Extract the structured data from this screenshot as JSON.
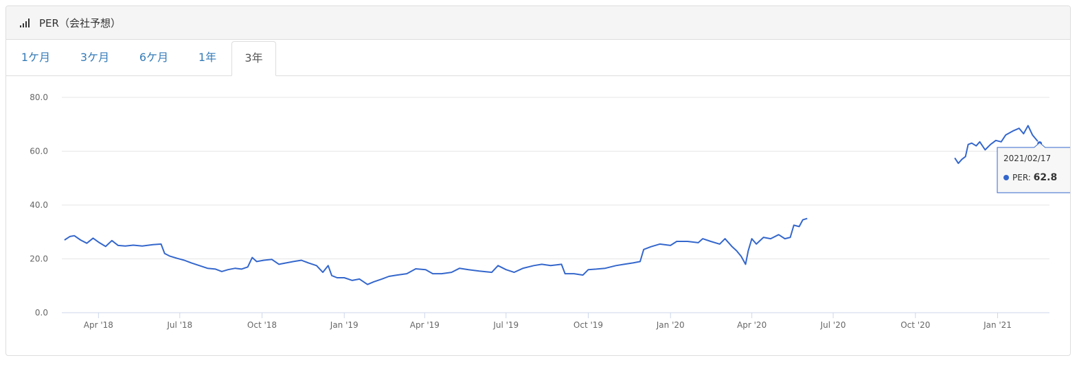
{
  "panel": {
    "title": "PER（会社予想）",
    "icon": "signal-bars-icon"
  },
  "tabs": [
    {
      "label": "1ケ月",
      "active": false
    },
    {
      "label": "3ケ月",
      "active": false
    },
    {
      "label": "6ケ月",
      "active": false
    },
    {
      "label": "1年",
      "active": false
    },
    {
      "label": "3年",
      "active": true
    }
  ],
  "colors": {
    "line": "#3366cc",
    "grid": "#e6e6e6",
    "tab_link": "#337ab7"
  },
  "chart_data": {
    "type": "line",
    "title": "",
    "xlabel": "",
    "ylabel": "",
    "ylim": [
      0,
      80
    ],
    "yticks": [
      "0.0",
      "20.0",
      "40.0",
      "60.0",
      "80.0"
    ],
    "xlim": [
      "2018-02-19",
      "2021-02-28"
    ],
    "xticks": [
      {
        "date": "2018-04-01",
        "label": "Apr '18"
      },
      {
        "date": "2018-07-01",
        "label": "Jul '18"
      },
      {
        "date": "2018-10-01",
        "label": "Oct '18"
      },
      {
        "date": "2019-01-01",
        "label": "Jan '19"
      },
      {
        "date": "2019-04-01",
        "label": "Apr '19"
      },
      {
        "date": "2019-07-01",
        "label": "Jul '19"
      },
      {
        "date": "2019-10-01",
        "label": "Oct '19"
      },
      {
        "date": "2020-01-01",
        "label": "Jan '20"
      },
      {
        "date": "2020-04-01",
        "label": "Apr '20"
      },
      {
        "date": "2020-07-01",
        "label": "Jul '20"
      },
      {
        "date": "2020-10-01",
        "label": "Oct '20"
      },
      {
        "date": "2021-01-01",
        "label": "Jan '21"
      }
    ],
    "grid": true,
    "legend": "none",
    "series": [
      {
        "name": "PER",
        "segments": [
          [
            [
              "2018-02-22",
              27.0
            ],
            [
              "2018-02-28",
              28.3
            ],
            [
              "2018-03-05",
              28.6
            ],
            [
              "2018-03-12",
              27.0
            ],
            [
              "2018-03-19",
              25.8
            ],
            [
              "2018-03-26",
              27.7
            ],
            [
              "2018-04-02",
              26.0
            ],
            [
              "2018-04-09",
              24.6
            ],
            [
              "2018-04-16",
              26.8
            ],
            [
              "2018-04-23",
              25.0
            ],
            [
              "2018-05-01",
              24.8
            ],
            [
              "2018-05-10",
              25.1
            ],
            [
              "2018-05-20",
              24.8
            ],
            [
              "2018-06-01",
              25.3
            ],
            [
              "2018-06-10",
              25.5
            ],
            [
              "2018-06-14",
              22.0
            ],
            [
              "2018-06-20",
              21.0
            ],
            [
              "2018-06-28",
              20.2
            ],
            [
              "2018-07-06",
              19.5
            ],
            [
              "2018-07-14",
              18.5
            ],
            [
              "2018-07-23",
              17.5
            ],
            [
              "2018-08-01",
              16.5
            ],
            [
              "2018-08-10",
              16.2
            ],
            [
              "2018-08-17",
              15.3
            ],
            [
              "2018-08-24",
              16.0
            ],
            [
              "2018-09-01",
              16.5
            ],
            [
              "2018-09-08",
              16.2
            ],
            [
              "2018-09-15",
              17.0
            ],
            [
              "2018-09-20",
              20.5
            ],
            [
              "2018-09-25",
              19.0
            ],
            [
              "2018-10-03",
              19.5
            ],
            [
              "2018-10-12",
              19.8
            ],
            [
              "2018-10-20",
              18.0
            ],
            [
              "2018-10-28",
              18.5
            ],
            [
              "2018-11-05",
              19.0
            ],
            [
              "2018-11-14",
              19.5
            ],
            [
              "2018-11-22",
              18.5
            ],
            [
              "2018-12-01",
              17.5
            ],
            [
              "2018-12-08",
              15.0
            ],
            [
              "2018-12-14",
              17.5
            ],
            [
              "2018-12-18",
              13.8
            ],
            [
              "2018-12-24",
              13.0
            ],
            [
              "2019-01-01",
              13.0
            ],
            [
              "2019-01-10",
              12.0
            ],
            [
              "2019-01-18",
              12.5
            ],
            [
              "2019-01-27",
              10.5
            ],
            [
              "2019-02-03",
              11.5
            ],
            [
              "2019-02-12",
              12.5
            ],
            [
              "2019-02-20",
              13.5
            ],
            [
              "2019-03-01",
              14.0
            ],
            [
              "2019-03-12",
              14.5
            ],
            [
              "2019-03-22",
              16.3
            ],
            [
              "2019-04-02",
              16.0
            ],
            [
              "2019-04-10",
              14.5
            ],
            [
              "2019-04-20",
              14.5
            ],
            [
              "2019-05-01",
              15.0
            ],
            [
              "2019-05-10",
              16.5
            ],
            [
              "2019-05-20",
              16.0
            ],
            [
              "2019-06-01",
              15.5
            ],
            [
              "2019-06-15",
              15.0
            ],
            [
              "2019-06-22",
              17.5
            ],
            [
              "2019-07-01",
              16.0
            ],
            [
              "2019-07-10",
              15.0
            ],
            [
              "2019-07-20",
              16.5
            ],
            [
              "2019-08-01",
              17.5
            ],
            [
              "2019-08-10",
              18.0
            ],
            [
              "2019-08-20",
              17.5
            ],
            [
              "2019-09-01",
              18.0
            ],
            [
              "2019-09-05",
              14.5
            ],
            [
              "2019-09-15",
              14.5
            ],
            [
              "2019-09-25",
              14.0
            ],
            [
              "2019-10-01",
              16.0
            ],
            [
              "2019-10-10",
              16.2
            ],
            [
              "2019-10-20",
              16.5
            ],
            [
              "2019-11-01",
              17.5
            ],
            [
              "2019-11-10",
              18.0
            ],
            [
              "2019-11-20",
              18.5
            ],
            [
              "2019-11-28",
              19.0
            ],
            [
              "2019-12-02",
              23.5
            ],
            [
              "2019-12-10",
              24.5
            ],
            [
              "2019-12-20",
              25.5
            ],
            [
              "2020-01-01",
              25.0
            ],
            [
              "2020-01-08",
              26.5
            ],
            [
              "2020-01-20",
              26.5
            ],
            [
              "2020-02-01",
              26.0
            ],
            [
              "2020-02-06",
              27.5
            ],
            [
              "2020-02-15",
              26.5
            ],
            [
              "2020-02-25",
              25.5
            ],
            [
              "2020-03-02",
              27.5
            ],
            [
              "2020-03-10",
              24.5
            ],
            [
              "2020-03-15",
              23.0
            ],
            [
              "2020-03-20",
              21.0
            ],
            [
              "2020-03-25",
              18.0
            ],
            [
              "2020-03-28",
              23.0
            ],
            [
              "2020-04-01",
              27.5
            ],
            [
              "2020-04-06",
              25.5
            ],
            [
              "2020-04-14",
              28.0
            ],
            [
              "2020-04-22",
              27.5
            ],
            [
              "2020-05-01",
              29.0
            ],
            [
              "2020-05-08",
              27.5
            ],
            [
              "2020-05-14",
              28.0
            ],
            [
              "2020-05-18",
              32.5
            ],
            [
              "2020-05-24",
              32.0
            ],
            [
              "2020-05-28",
              34.5
            ],
            [
              "2020-06-02",
              35.0
            ]
          ],
          [
            [
              "2020-11-14",
              57.5
            ],
            [
              "2020-11-18",
              55.5
            ],
            [
              "2020-11-22",
              57.0
            ],
            [
              "2020-11-26",
              58.0
            ],
            [
              "2020-11-29",
              62.5
            ],
            [
              "2020-12-03",
              63.0
            ],
            [
              "2020-12-08",
              62.0
            ],
            [
              "2020-12-12",
              63.5
            ],
            [
              "2020-12-18",
              60.5
            ],
            [
              "2020-12-24",
              62.5
            ],
            [
              "2020-12-30",
              64.0
            ],
            [
              "2021-01-05",
              63.5
            ],
            [
              "2021-01-10",
              66.0
            ],
            [
              "2021-01-18",
              67.5
            ],
            [
              "2021-01-25",
              68.5
            ],
            [
              "2021-01-30",
              66.5
            ],
            [
              "2021-02-04",
              69.5
            ],
            [
              "2021-02-09",
              66.0
            ],
            [
              "2021-02-14",
              64.0
            ],
            [
              "2021-02-17",
              62.8
            ]
          ]
        ]
      }
    ],
    "tooltip": {
      "date": "2021/02/17",
      "series": "PER",
      "value": "62.8"
    }
  }
}
